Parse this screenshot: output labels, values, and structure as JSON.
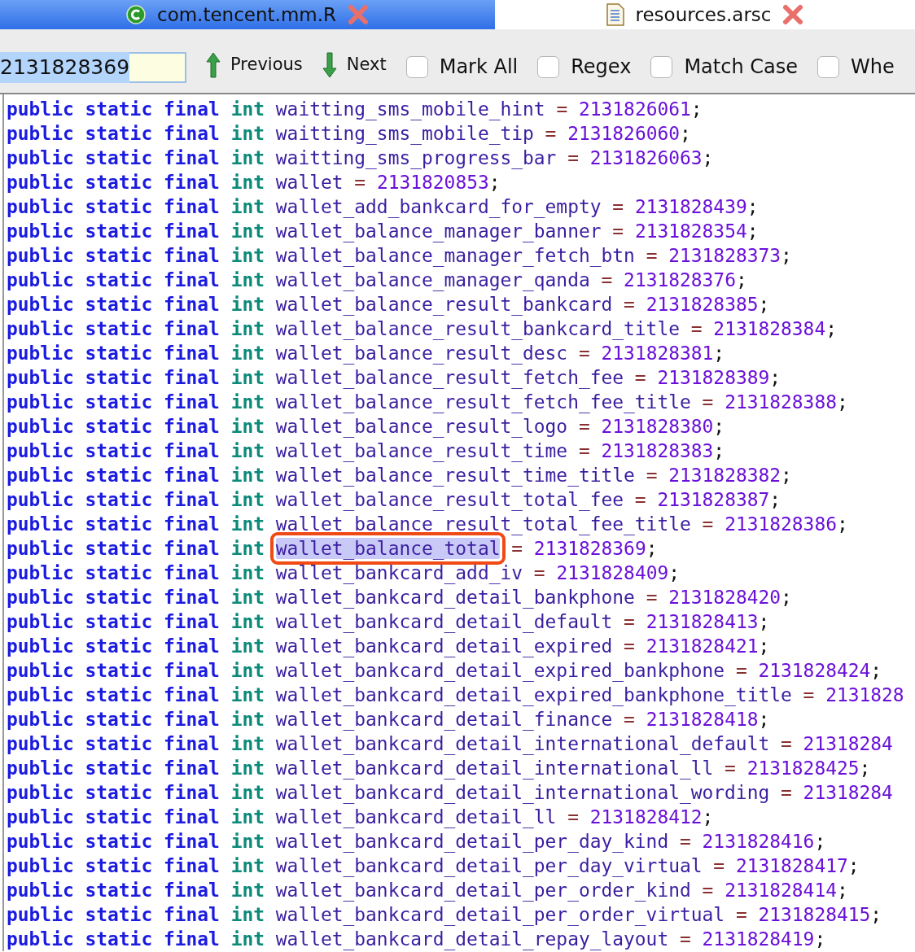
{
  "tabs": [
    {
      "label": "com.tencent.mm.R",
      "kind": "class",
      "selected": true
    },
    {
      "label": "resources.arsc",
      "kind": "file",
      "selected": false
    }
  ],
  "search": {
    "value": "2131828369",
    "selected_text": true,
    "buttons": [
      {
        "label": "Previous",
        "kind": "up"
      },
      {
        "label": "Next",
        "kind": "down"
      }
    ],
    "options": [
      {
        "label": "Mark All",
        "checked": false
      },
      {
        "label": "Regex",
        "checked": false
      },
      {
        "label": "Match Case",
        "checked": false
      },
      {
        "label": "Whe",
        "checked": false
      }
    ]
  },
  "code_lines": [
    {
      "modifiers": "public static final",
      "type": "int",
      "name": "waitting_sms_mobile_hint",
      "operator": "=",
      "value": "2131826061",
      "terminator": ";",
      "highlighted": false
    },
    {
      "modifiers": "public static final",
      "type": "int",
      "name": "waitting_sms_mobile_tip",
      "operator": "=",
      "value": "2131826060",
      "terminator": ";",
      "highlighted": false
    },
    {
      "modifiers": "public static final",
      "type": "int",
      "name": "waitting_sms_progress_bar",
      "operator": "=",
      "value": "2131826063",
      "terminator": ";",
      "highlighted": false
    },
    {
      "modifiers": "public static final",
      "type": "int",
      "name": "wallet",
      "operator": "=",
      "value": "2131820853",
      "terminator": ";",
      "highlighted": false
    },
    {
      "modifiers": "public static final",
      "type": "int",
      "name": "wallet_add_bankcard_for_empty",
      "operator": "=",
      "value": "2131828439",
      "terminator": ";",
      "highlighted": false
    },
    {
      "modifiers": "public static final",
      "type": "int",
      "name": "wallet_balance_manager_banner",
      "operator": "=",
      "value": "2131828354",
      "terminator": ";",
      "highlighted": false
    },
    {
      "modifiers": "public static final",
      "type": "int",
      "name": "wallet_balance_manager_fetch_btn",
      "operator": "=",
      "value": "2131828373",
      "terminator": ";",
      "highlighted": false
    },
    {
      "modifiers": "public static final",
      "type": "int",
      "name": "wallet_balance_manager_qanda",
      "operator": "=",
      "value": "2131828376",
      "terminator": ";",
      "highlighted": false
    },
    {
      "modifiers": "public static final",
      "type": "int",
      "name": "wallet_balance_result_bankcard",
      "operator": "=",
      "value": "2131828385",
      "terminator": ";",
      "highlighted": false
    },
    {
      "modifiers": "public static final",
      "type": "int",
      "name": "wallet_balance_result_bankcard_title",
      "operator": "=",
      "value": "2131828384",
      "terminator": ";",
      "highlighted": false
    },
    {
      "modifiers": "public static final",
      "type": "int",
      "name": "wallet_balance_result_desc",
      "operator": "=",
      "value": "2131828381",
      "terminator": ";",
      "highlighted": false
    },
    {
      "modifiers": "public static final",
      "type": "int",
      "name": "wallet_balance_result_fetch_fee",
      "operator": "=",
      "value": "2131828389",
      "terminator": ";",
      "highlighted": false
    },
    {
      "modifiers": "public static final",
      "type": "int",
      "name": "wallet_balance_result_fetch_fee_title",
      "operator": "=",
      "value": "2131828388",
      "terminator": ";",
      "highlighted": false
    },
    {
      "modifiers": "public static final",
      "type": "int",
      "name": "wallet_balance_result_logo",
      "operator": "=",
      "value": "2131828380",
      "terminator": ";",
      "highlighted": false
    },
    {
      "modifiers": "public static final",
      "type": "int",
      "name": "wallet_balance_result_time",
      "operator": "=",
      "value": "2131828383",
      "terminator": ";",
      "highlighted": false
    },
    {
      "modifiers": "public static final",
      "type": "int",
      "name": "wallet_balance_result_time_title",
      "operator": "=",
      "value": "2131828382",
      "terminator": ";",
      "highlighted": false
    },
    {
      "modifiers": "public static final",
      "type": "int",
      "name": "wallet_balance_result_total_fee",
      "operator": "=",
      "value": "2131828387",
      "terminator": ";",
      "highlighted": false
    },
    {
      "modifiers": "public static final",
      "type": "int",
      "name": "wallet_balance_result_total_fee_title",
      "operator": "=",
      "value": "2131828386",
      "terminator": ";",
      "highlighted": false
    },
    {
      "modifiers": "public static final",
      "type": "int",
      "name": "wallet_balance_total",
      "operator": "=",
      "value": "2131828369",
      "terminator": ";",
      "highlighted": true
    },
    {
      "modifiers": "public static final",
      "type": "int",
      "name": "wallet_bankcard_add_iv",
      "operator": "=",
      "value": "2131828409",
      "terminator": ";",
      "highlighted": false
    },
    {
      "modifiers": "public static final",
      "type": "int",
      "name": "wallet_bankcard_detail_bankphone",
      "operator": "=",
      "value": "2131828420",
      "terminator": ";",
      "highlighted": false
    },
    {
      "modifiers": "public static final",
      "type": "int",
      "name": "wallet_bankcard_detail_default",
      "operator": "=",
      "value": "2131828413",
      "terminator": ";",
      "highlighted": false
    },
    {
      "modifiers": "public static final",
      "type": "int",
      "name": "wallet_bankcard_detail_expired",
      "operator": "=",
      "value": "2131828421",
      "terminator": ";",
      "highlighted": false
    },
    {
      "modifiers": "public static final",
      "type": "int",
      "name": "wallet_bankcard_detail_expired_bankphone",
      "operator": "=",
      "value": "2131828424",
      "terminator": ";",
      "highlighted": false
    },
    {
      "modifiers": "public static final",
      "type": "int",
      "name": "wallet_bankcard_detail_expired_bankphone_title",
      "operator": "=",
      "value": "2131828",
      "highlighted": false
    },
    {
      "modifiers": "public static final",
      "type": "int",
      "name": "wallet_bankcard_detail_finance",
      "operator": "=",
      "value": "2131828418",
      "terminator": ";",
      "highlighted": false
    },
    {
      "modifiers": "public static final",
      "type": "int",
      "name": "wallet_bankcard_detail_international_default",
      "operator": "=",
      "value": "21318284",
      "highlighted": false
    },
    {
      "modifiers": "public static final",
      "type": "int",
      "name": "wallet_bankcard_detail_international_ll",
      "operator": "=",
      "value": "2131828425",
      "terminator": ";",
      "highlighted": false
    },
    {
      "modifiers": "public static final",
      "type": "int",
      "name": "wallet_bankcard_detail_international_wording",
      "operator": "=",
      "value": "21318284",
      "highlighted": false
    },
    {
      "modifiers": "public static final",
      "type": "int",
      "name": "wallet_bankcard_detail_ll",
      "operator": "=",
      "value": "2131828412",
      "terminator": ";",
      "highlighted": false
    },
    {
      "modifiers": "public static final",
      "type": "int",
      "name": "wallet_bankcard_detail_per_day_kind",
      "operator": "=",
      "value": "2131828416",
      "terminator": ";",
      "highlighted": false
    },
    {
      "modifiers": "public static final",
      "type": "int",
      "name": "wallet_bankcard_detail_per_day_virtual",
      "operator": "=",
      "value": "2131828417",
      "terminator": ";",
      "highlighted": false
    },
    {
      "modifiers": "public static final",
      "type": "int",
      "name": "wallet_bankcard_detail_per_order_kind",
      "operator": "=",
      "value": "2131828414",
      "terminator": ";",
      "highlighted": false
    },
    {
      "modifiers": "public static final",
      "type": "int",
      "name": "wallet_bankcard_detail_per_order_virtual",
      "operator": "=",
      "value": "2131828415",
      "terminator": ";",
      "highlighted": false
    },
    {
      "modifiers": "public static final",
      "type": "int",
      "name": "wallet_bankcard_detail_repay_layout",
      "operator": "=",
      "value": "2131828419",
      "terminator": ";",
      "highlighted": false
    }
  ]
}
